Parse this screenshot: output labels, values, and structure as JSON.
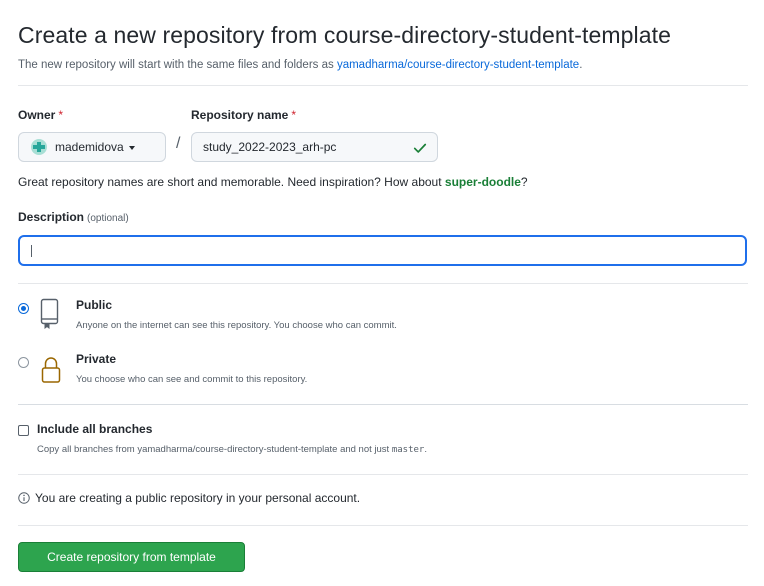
{
  "header": {
    "title": "Create a new repository from course-directory-student-template",
    "subtitle_prefix": "The new repository will start with the same files and folders as",
    "template_link": "yamadharma/course-directory-student-template",
    "subtitle_suffix": "."
  },
  "owner": {
    "label": "Owner",
    "required_mark": "*",
    "value": "mademidova",
    "avatar_icon": "identicon-avatar"
  },
  "separator": "/",
  "repo_name": {
    "label": "Repository name",
    "required_mark": "*",
    "value": "study_2022-2023_arh-pc",
    "status_icon": "check-icon",
    "status_color": "#1a7f37"
  },
  "name_hint": {
    "text": "Great repository names are short and memorable. Need inspiration? How about",
    "suggestion": "super-doodle",
    "suffix": "?"
  },
  "description": {
    "label": "Description",
    "optional_label": "(optional)",
    "value": ""
  },
  "visibility": {
    "selected": "public",
    "options": [
      {
        "id": "public",
        "title": "Public",
        "description": "Anyone on the internet can see this repository. You choose who can commit.",
        "icon": "repo-icon"
      },
      {
        "id": "private",
        "title": "Private",
        "description": "You choose who can see and commit to this repository.",
        "icon": "lock-icon"
      }
    ]
  },
  "branches": {
    "label": "Include all branches",
    "checked": false,
    "desc_prefix": "Copy all branches from yamadharma/course-directory-student-template and not just",
    "desc_branch": "master",
    "desc_suffix": "."
  },
  "notice": {
    "icon": "info-icon",
    "text": "You are creating a public repository in your personal account."
  },
  "submit": {
    "label": "Create repository from template",
    "color": "#2da44e"
  }
}
